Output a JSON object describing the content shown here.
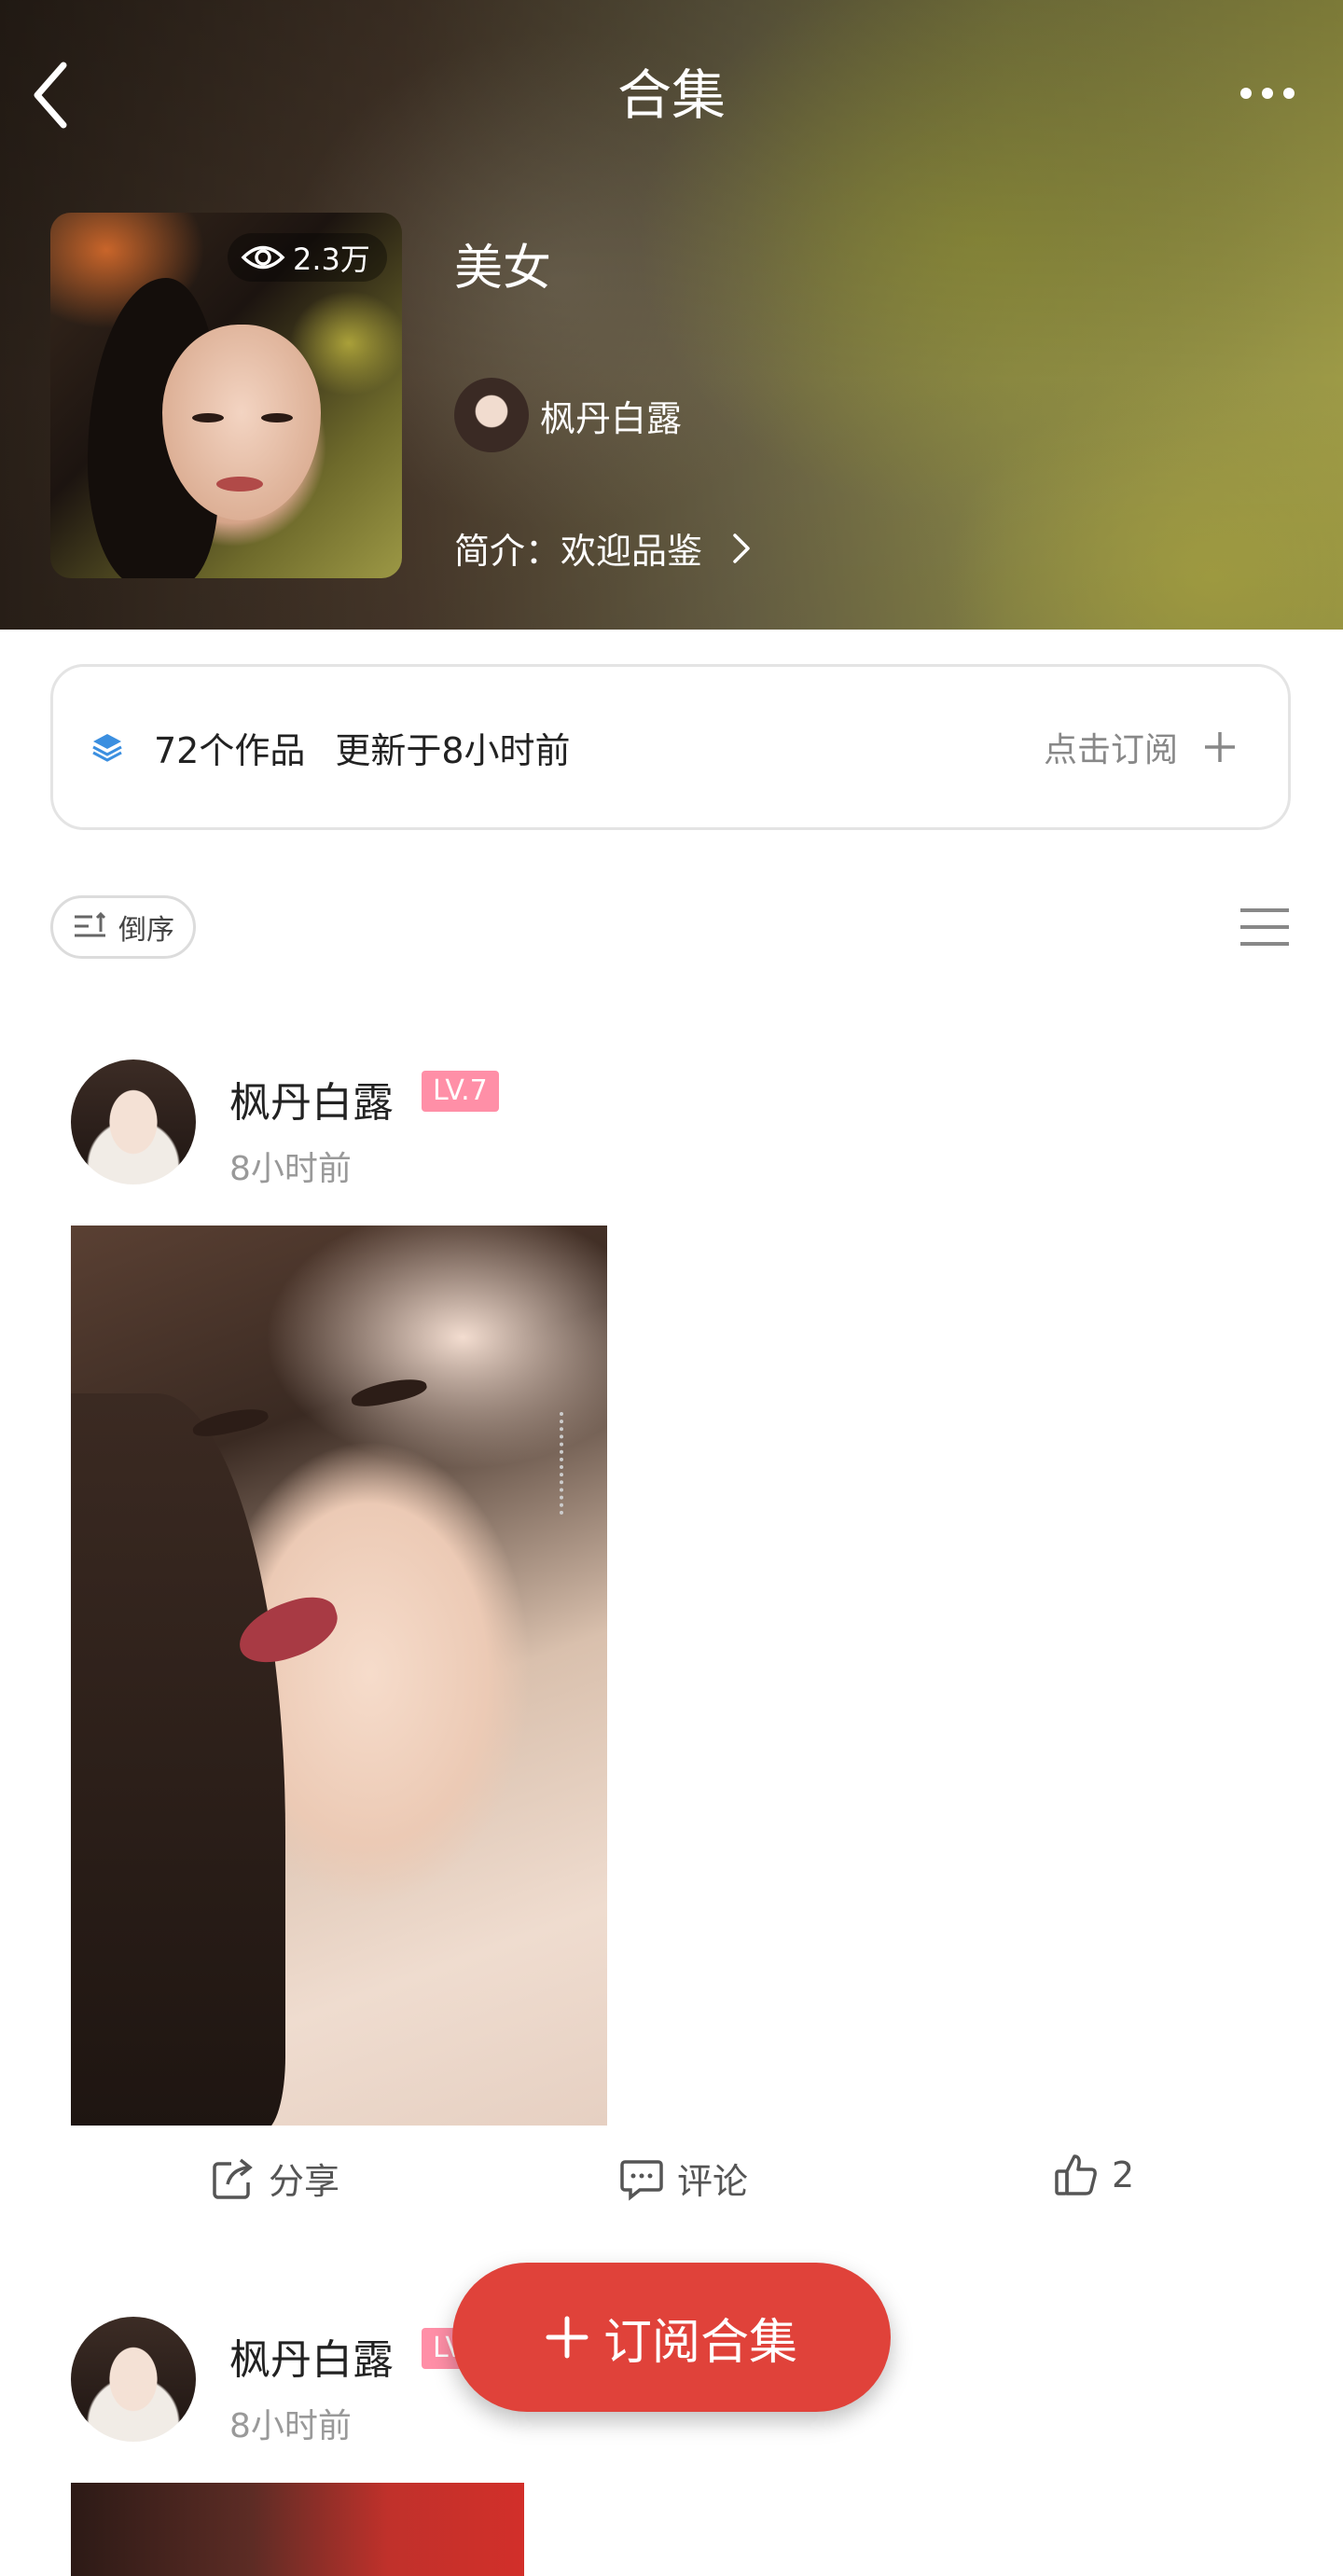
{
  "header": {
    "title": "合集",
    "back_icon": "chevron-left-icon",
    "more_icon": "more-dots-icon"
  },
  "collection": {
    "views": "2.3万",
    "name": "美女",
    "owner_name": "枫丹白露",
    "intro": "简介：欢迎品鉴"
  },
  "stats": {
    "works": "72个作品",
    "updated": "更新于8小时前",
    "subscribe_label": "点击订阅"
  },
  "sort": {
    "label": "倒序"
  },
  "posts": [
    {
      "author": "枫丹白露",
      "level": "LV.7",
      "time": "8小时前",
      "share_label": "分享",
      "comment_label": "评论",
      "likes": "2"
    },
    {
      "author": "枫丹白露",
      "level": "LV.7",
      "time": "8小时前"
    }
  ],
  "fab": {
    "label": "订阅合集"
  },
  "colors": {
    "accent_red": "#e0423a",
    "level_badge": "#ff8fa7",
    "layers_icon": "#3b8fe0"
  }
}
